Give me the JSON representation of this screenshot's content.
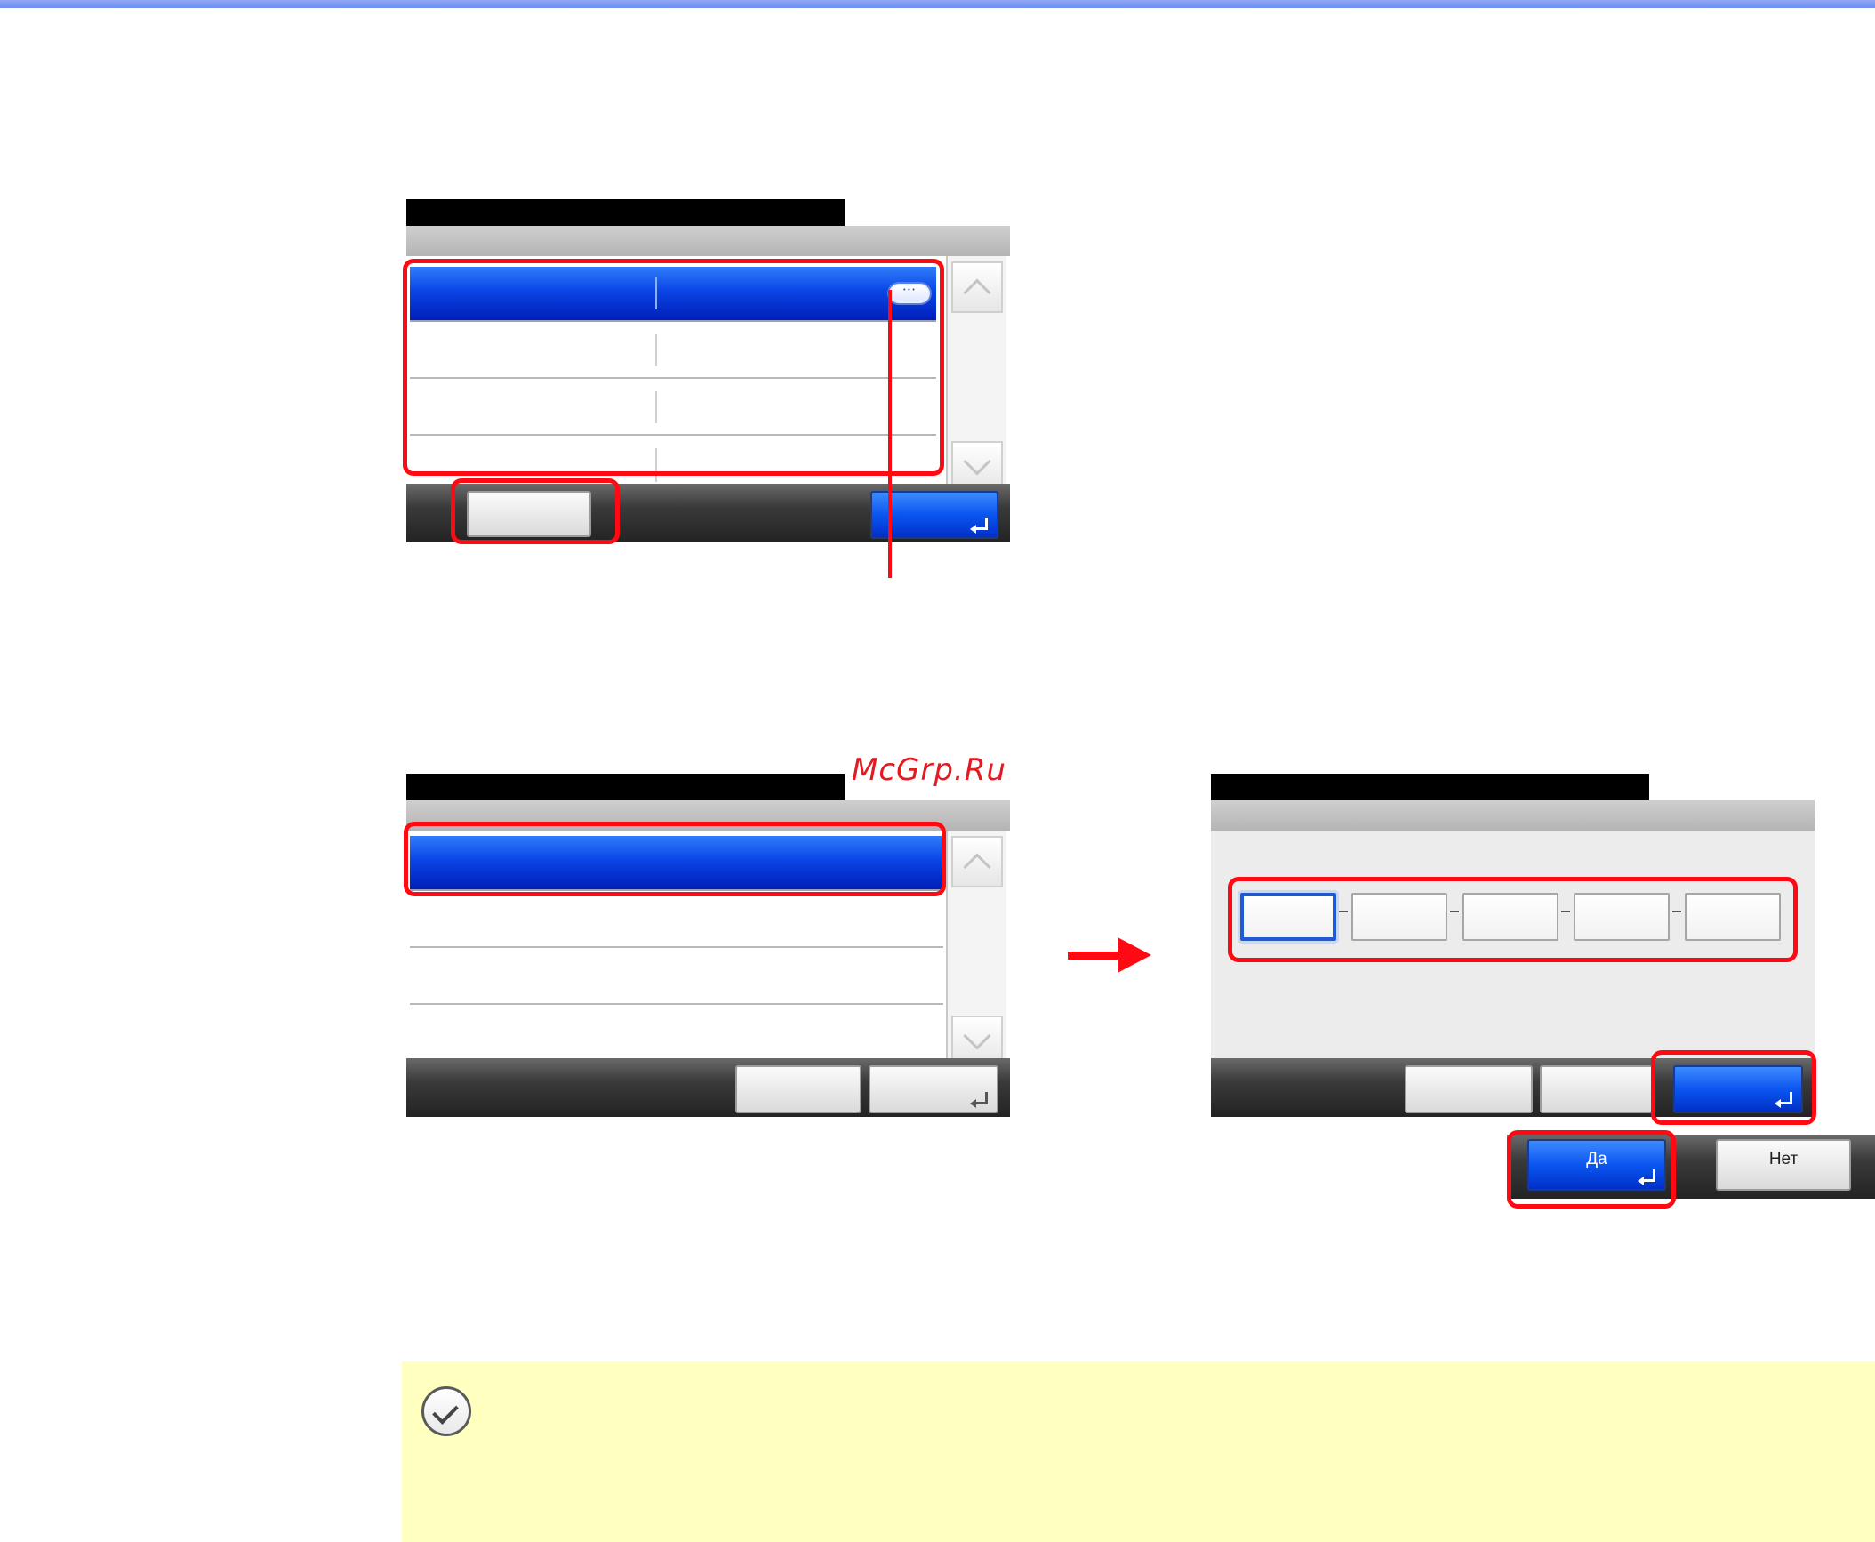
{
  "watermark": "McGrp.Ru",
  "confirm_dialog": {
    "yes_label": "Да",
    "no_label": "Нет"
  },
  "icons": {
    "note": "check-circle-icon",
    "arrow": "right-arrow-icon",
    "detail": "more-dots-icon",
    "enter": "enter-key-icon"
  },
  "colors": {
    "highlight": "#ff0a12",
    "selection": "#0a45e6",
    "note_background": "#ffffbf",
    "top_rule": "#6d8ff0"
  }
}
